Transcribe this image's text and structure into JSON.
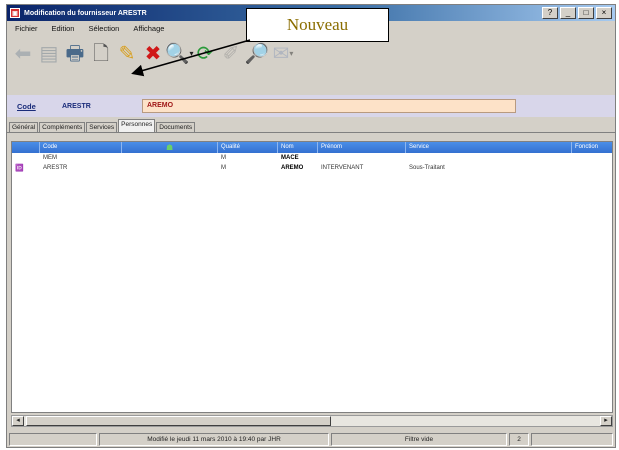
{
  "window": {
    "title": "Modification du fournisseur ARESTR",
    "controls": [
      "?",
      "_",
      "□",
      "×"
    ]
  },
  "menu": [
    "Fichier",
    "Edition",
    "Sélection",
    "Affichage"
  ],
  "callout": {
    "text": "Nouveau"
  },
  "toolbar": [
    {
      "icon": "back-arrow-icon",
      "glyph": "⬅",
      "disabled": true,
      "color": "#7a8a9a"
    },
    {
      "icon": "save-icon",
      "glyph": "▤",
      "disabled": true,
      "color": "#6a7a8a"
    },
    {
      "icon": "print-icon",
      "glyph": "🖶",
      "disabled": false,
      "color": "#4a6a8a"
    },
    {
      "icon": "new-document-icon",
      "glyph": "🗋",
      "disabled": false,
      "color": "#555555"
    },
    {
      "icon": "edit-icon",
      "glyph": "✎",
      "disabled": false,
      "color": "#d8a020"
    },
    {
      "icon": "delete-icon",
      "glyph": "✖",
      "disabled": false,
      "color": "#d01818"
    },
    {
      "icon": "search-icon",
      "glyph": "🔍",
      "disabled": false,
      "color": "#c09030",
      "dropdown": true
    },
    {
      "icon": "refresh-icon",
      "glyph": "⟳",
      "disabled": false,
      "color": "#2a9a3a"
    },
    {
      "icon": "pen-icon",
      "glyph": "✐",
      "disabled": true,
      "color": "#888888"
    },
    {
      "icon": "zoom-icon",
      "glyph": "🔎",
      "disabled": false,
      "color": "#c8a030"
    },
    {
      "icon": "mail-icon",
      "glyph": "✉",
      "disabled": true,
      "color": "#8898b8",
      "dropdown": true
    }
  ],
  "code_bar": {
    "label": "Code",
    "code": "ARESTR",
    "name": "AREMO"
  },
  "tabs": [
    {
      "label": "Général",
      "active": false
    },
    {
      "label": "Compléments",
      "active": false
    },
    {
      "label": "Services",
      "active": false
    },
    {
      "label": "Personnes",
      "active": true
    },
    {
      "label": "Documents",
      "active": false
    }
  ],
  "grid": {
    "columns": [
      "",
      "Code",
      "",
      "Qualité",
      "Nom",
      "Prénom",
      "Service",
      "Fonction"
    ],
    "header_icon": "contact-icon",
    "rows": [
      {
        "marker": "",
        "code": "MEM",
        "qualite": "M",
        "nom": "MACE",
        "prenom": "",
        "service": "",
        "fonction": ""
      },
      {
        "marker": "contact-card-icon",
        "code": "ARESTR",
        "qualite": "M",
        "nom": "AREMO",
        "prenom": "INTERVENANT",
        "service": "Sous-Traitant",
        "fonction": ""
      }
    ]
  },
  "scrollbar": {
    "left": "◂",
    "right": "▸"
  },
  "status": {
    "modified": "Modifié le jeudi 11 mars 2010 à 19:40 par JHR",
    "filter": "Filtre vide",
    "count": "2"
  },
  "colors": {
    "header_blue": "#3a7ee0",
    "code_bar_bg": "#d8d6ea",
    "name_field_bg": "#fde2c8",
    "accent_text": "#1a2c7a"
  }
}
